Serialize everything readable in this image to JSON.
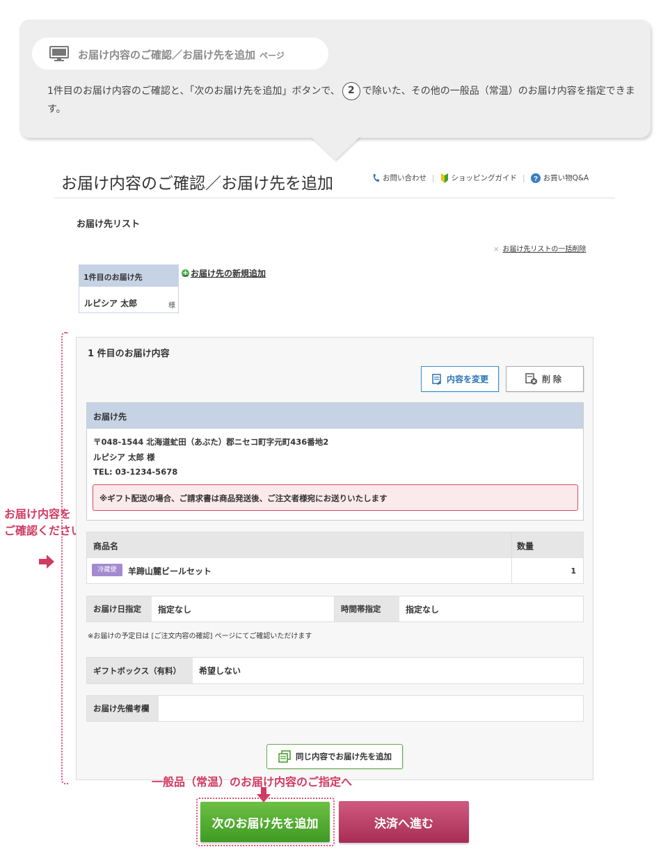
{
  "balloon": {
    "page_title": "お届け内容のご確認／お届け先を追加",
    "page_suffix": "ページ",
    "text_before": "1件目のお届け内容のご確認と、「次のお届け先を追加」ボタンで、",
    "circle_number": "2",
    "text_after": "で除いた、その他の一般品（常温）のお届け内容を指定できます。"
  },
  "header": {
    "title": "お届け内容のご確認／お届け先を追加",
    "links": [
      {
        "label": "お問い合わせ",
        "icon": "phone-icon"
      },
      {
        "label": "ショッピングガイド",
        "icon": "beginner-mark-icon"
      },
      {
        "label": "お買い物Q&A",
        "icon": "question-icon"
      }
    ]
  },
  "dest_list": {
    "title": "お届け先リスト",
    "bulk_delete_x": "×",
    "bulk_delete": "お届け先リストの一括削除",
    "card_header": "1件目のお届け先",
    "card_name": "ルピシア 太郎",
    "card_sama": "様",
    "new_add": "お届け先の新規追加"
  },
  "annotation": {
    "side_line1": "お届け内容を",
    "side_line2": "ご確認ください",
    "bottom": "一般品（常温）のお届け内容のご指定へ"
  },
  "detail": {
    "title": "1 件目のお届け内容",
    "edit_button": "内容を変更",
    "delete_button": "削除",
    "address_header": "お届け先",
    "address_line1": "〒048-1544 北海道虻田（あぶた）郡ニセコ町字元町436番地2",
    "address_line2": "ルピシア 太郎 様",
    "address_line3": "TEL: 03-1234-5678",
    "gift_notice": "※ギフト配送の場合、ご請求書は商品発送後、ご注文者様宛にお送りいたします",
    "product_header": "商品名",
    "quantity_header": "数量",
    "products": [
      {
        "badge": "冷蔵便",
        "name": "羊蹄山麓ビールセット",
        "qty": "1"
      }
    ],
    "delivery_date_label": "お届け日指定",
    "delivery_date_value": "指定なし",
    "time_label": "時間帯指定",
    "time_value": "指定なし",
    "date_note": "※お届けの予定日は [ご注文内容の確認] ページにてご確認いただけます",
    "giftbox_label": "ギフトボックス（有料）",
    "giftbox_value": "希望しない",
    "remarks_label": "お届け先備考欄",
    "remarks_value": "",
    "same_add_button": "同じ内容でお届け先を追加"
  },
  "actions": {
    "next_button": "次のお届け先を追加",
    "pay_button": "決済へ進む"
  },
  "colors": {
    "accent_pink": "#d13a62",
    "green": "#4a9f2c",
    "blue_header": "#c6d3e4",
    "edit_blue": "#3a8dc9"
  }
}
